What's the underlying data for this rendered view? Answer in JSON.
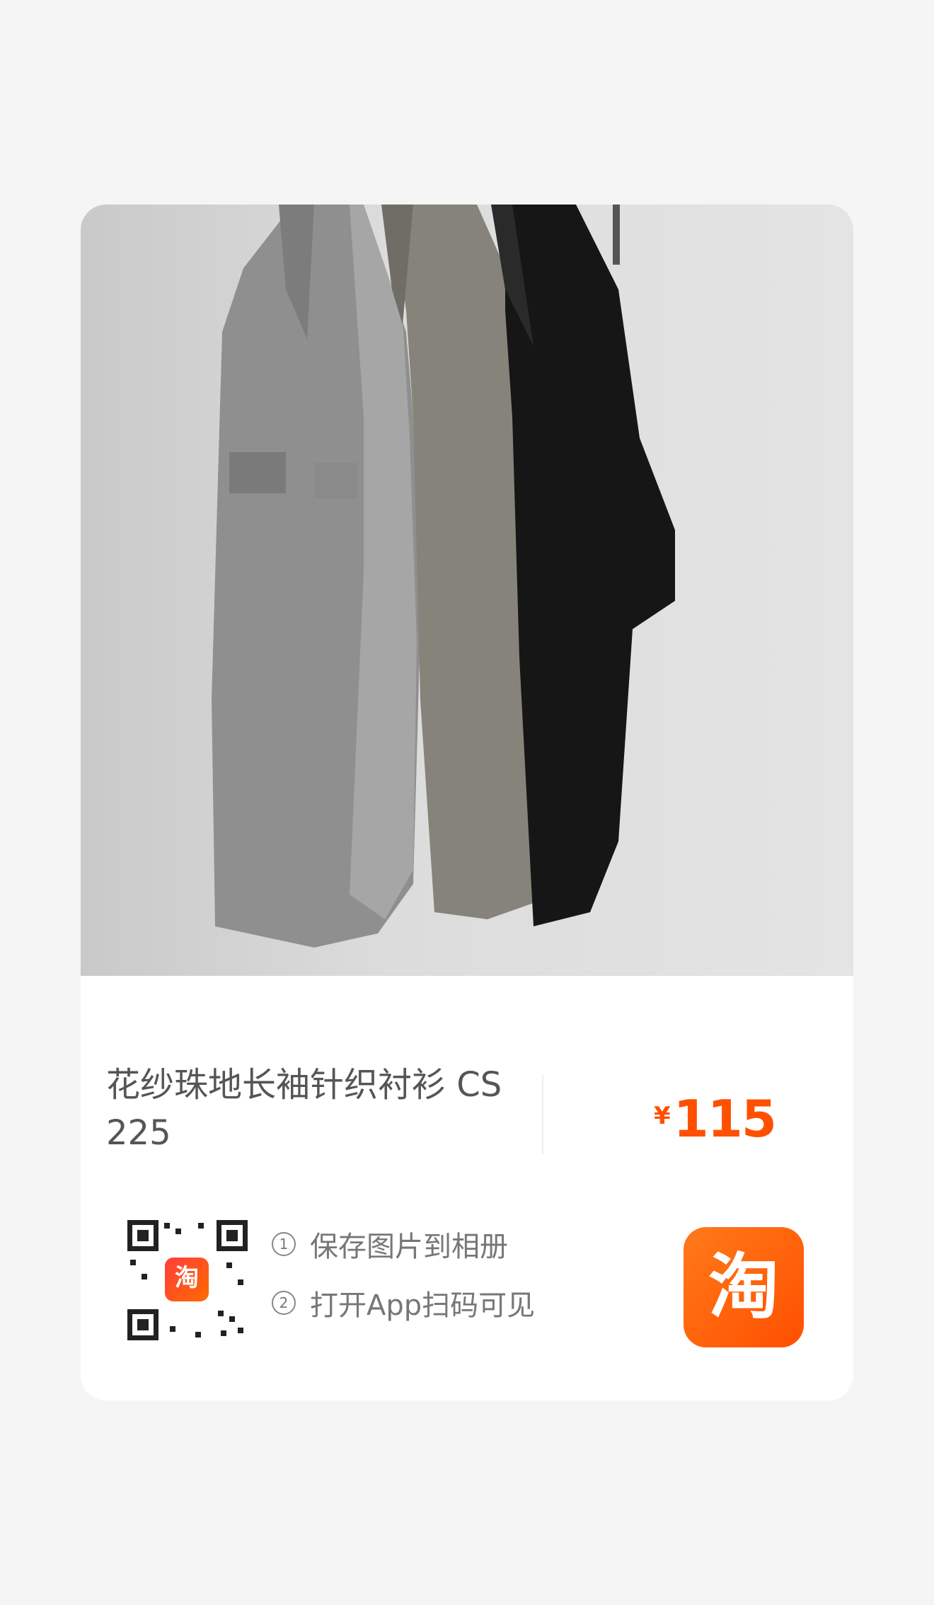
{
  "product": {
    "title": "花纱珠地长袖针织衬衫 CS 225",
    "currency_symbol": "¥",
    "price": "115"
  },
  "qr": {
    "badge_text": "淘"
  },
  "steps": [
    {
      "number": "1",
      "text": "保存图片到相册"
    },
    {
      "number": "2",
      "text": "打开App扫码可见"
    }
  ],
  "logo": {
    "text": "淘"
  },
  "colors": {
    "price": "#ff5000",
    "logo": "#ff5a00",
    "background": "#f5f5f5"
  }
}
